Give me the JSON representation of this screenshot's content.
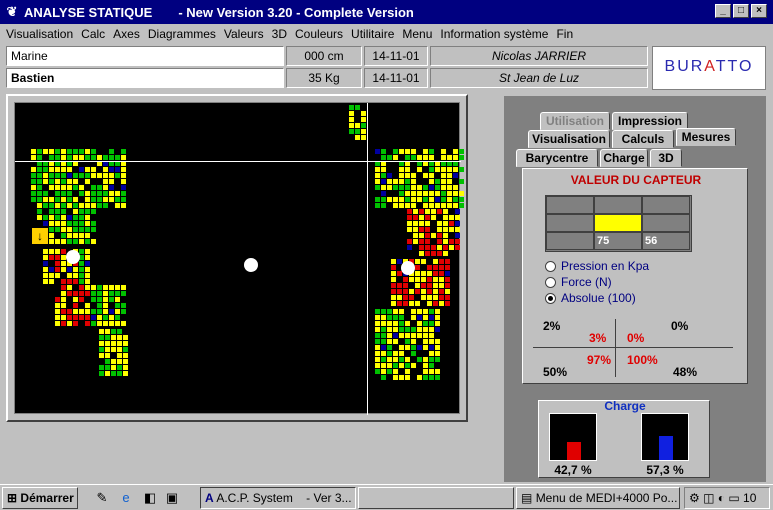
{
  "window": {
    "title": "ANALYSE STATIQUE",
    "subtitle": "- New Version 3.20 - Complete Version",
    "minimize_label": "_",
    "maximize_label": "□",
    "close_label": "×"
  },
  "menu": [
    "Visualisation",
    "Calc",
    "Axes",
    "Diagrammes",
    "Valeurs",
    "3D",
    "Couleurs",
    "Utilitaire",
    "Menu",
    "Information système",
    "Fin"
  ],
  "patient": {
    "name": "Marine",
    "row2_label": "Bastien",
    "height": "000 cm",
    "weight": "35  Kg",
    "date1": "14-11-01",
    "date2": "14-11-01",
    "practitioner": "Nicolas JARRIER",
    "city": "St Jean de Luz"
  },
  "logo": {
    "text_pre": "BUR",
    "text_a": "A",
    "text_post": "TTO"
  },
  "viewer": {
    "arrow_glyph": "↓"
  },
  "tabs": [
    "Utilisation",
    "Impression",
    "Visualisation",
    "Calculs",
    "Mesures",
    "Barycentre",
    "Charge",
    "3D"
  ],
  "sensor": {
    "title": "VALEUR DU CAPTEUR",
    "cell_values": [
      "75",
      "56"
    ],
    "highlight_color": "#ffff00",
    "radio_options": [
      "Pression en Kpa",
      "Force (N)",
      "Absolue  (100)"
    ],
    "selected_option": "Absolue  (100)"
  },
  "quadrants": {
    "tl_outer": "2%",
    "tl_inner": "3%",
    "tr_inner": "0%",
    "tr_outer": "0%",
    "bl_inner": "97%",
    "bl_outer": "50%",
    "br_inner": "100%",
    "br_outer": "48%"
  },
  "charge": {
    "title": "Charge",
    "left_pct": "42,7 %",
    "right_pct": "57,3 %",
    "left_fraction": 0.427,
    "right_fraction": 0.573,
    "left_color": "#e00000",
    "right_color": "#1020e0"
  },
  "taskbar": {
    "start": "Démarrer",
    "app1": "A.C.P. System",
    "app1_suffix": "- Ver 3...",
    "app2": "Menu de MEDI+4000 Po...",
    "clock": "10"
  },
  "pressure_colors": {
    "low": "#00c000",
    "mid": "#ffff00",
    "high": "#e00000",
    "edge": "#0000a0"
  }
}
